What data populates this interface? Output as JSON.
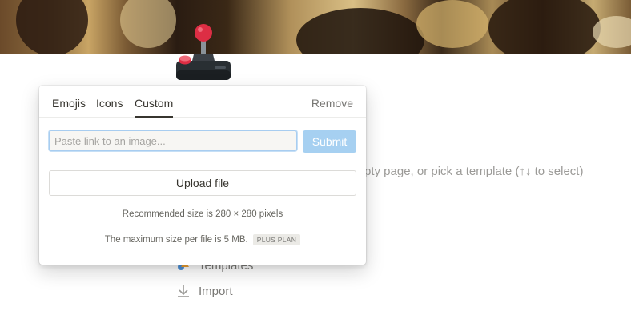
{
  "background": {
    "hint_text": "pty page, or pick a template (↑↓ to select)",
    "links": [
      {
        "label": "Templates",
        "icon": "templates-icon"
      },
      {
        "label": "Import",
        "icon": "import-icon"
      }
    ]
  },
  "page_icon": {
    "icon": "joystick-icon"
  },
  "icon_picker": {
    "tabs": [
      {
        "label": "Emojis",
        "active": false
      },
      {
        "label": "Icons",
        "active": false
      },
      {
        "label": "Custom",
        "active": true
      }
    ],
    "remove_label": "Remove",
    "link_input": {
      "value": "",
      "placeholder": "Paste link to an image..."
    },
    "submit_label": "Submit",
    "upload_label": "Upload file",
    "recommended_text": "Recommended size is 280 × 280 pixels",
    "max_size_text": "The maximum size per file is 5 MB.",
    "plan_badge": "PLUS PLAN"
  },
  "colors": {
    "accent": "#a6d0f1",
    "text": "#37352f",
    "muted": "#787774"
  }
}
